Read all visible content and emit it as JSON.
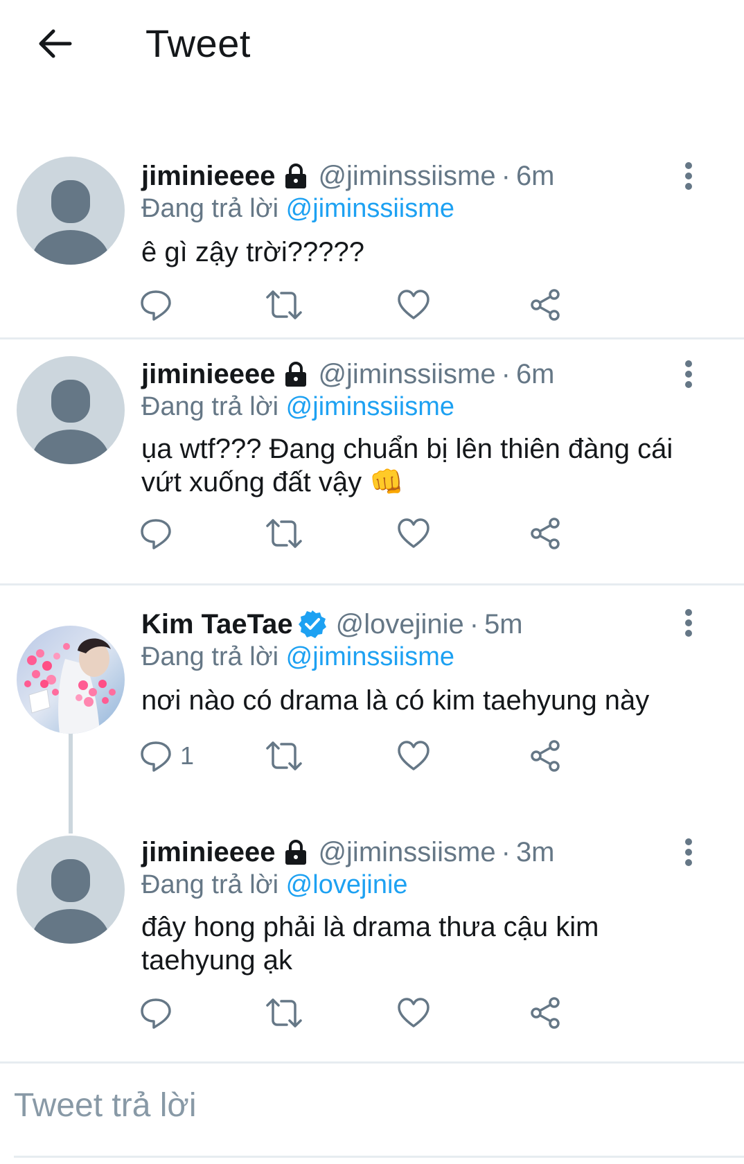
{
  "header": {
    "title": "Tweet"
  },
  "tweets": [
    {
      "name": "jiminieeee",
      "handle": "@jiminssiisme",
      "dot": "·",
      "time": "6m",
      "replying_prefix": "Đang trả lời",
      "replying_to": "@jiminssiisme",
      "text": "ê gì zậy trời?????",
      "reply_count": ""
    },
    {
      "name": "jiminieeee",
      "handle": "@jiminssiisme",
      "dot": "·",
      "time": "6m",
      "replying_prefix": "Đang trả lời",
      "replying_to": "@jiminssiisme",
      "text_line1": "ụa wtf??? Đang chuẩn bị lên thiên đàng cái",
      "text_line2": "vứt xuống đất vậy 👊",
      "reply_count": ""
    },
    {
      "name": "Kim TaeTae",
      "handle": "@lovejinie",
      "dot": "·",
      "time": "5m",
      "replying_prefix": "Đang trả lời",
      "replying_to": "@jiminssiisme",
      "text": "nơi nào có drama là có kim taehyung này",
      "reply_count": "1"
    },
    {
      "name": "jiminieeee",
      "handle": "@jiminssiisme",
      "dot": "·",
      "time": "3m",
      "replying_prefix": "Đang trả lời",
      "replying_to": "@lovejinie",
      "text_line1": "đây hong phải là drama thưa cậu kim",
      "text_line2": "taehyung ạk",
      "reply_count": ""
    }
  ],
  "reply_bar": {
    "placeholder": "Tweet trả lời"
  },
  "colors": {
    "link": "#1da1f2",
    "secondary": "#657786",
    "icon": "#657786",
    "divider": "#e6ecf0"
  },
  "icons": [
    "back-arrow-icon",
    "lock-icon",
    "verified-badge-icon",
    "more-vertical-icon",
    "reply-icon",
    "retweet-icon",
    "like-icon",
    "share-icon"
  ]
}
